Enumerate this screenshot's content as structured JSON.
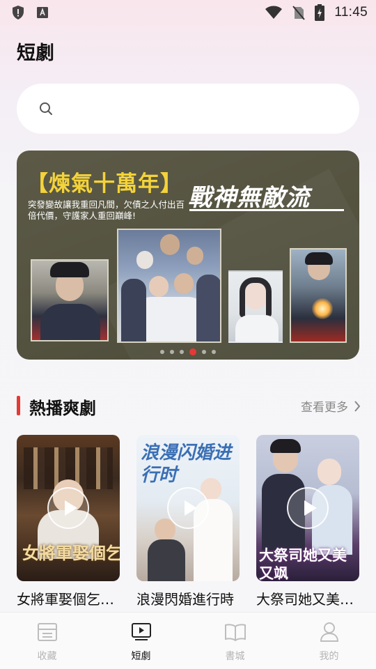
{
  "status_bar": {
    "time": "11:45"
  },
  "header": {
    "title": "短劇"
  },
  "search": {
    "placeholder": ""
  },
  "banner": {
    "title_left": "【煉氣十萬年】",
    "title_right": "戰神無敵流",
    "description": "突發變故讓我重回凡間，欠債之人付出百倍代價，守護家人重回巔峰!",
    "page_count": 6,
    "active_page": 3
  },
  "section": {
    "title": "熱播爽劇",
    "see_more": "查看更多"
  },
  "cards": [
    {
      "title": "女將軍娶個乞丐當王妃",
      "art_text": "女將軍娶個乞丐"
    },
    {
      "title": "浪漫閃婚進行時",
      "art_text": "浪漫闪婚进行时"
    },
    {
      "title": "大祭司她又美又颯",
      "art_text": "大祭司她又美又飒"
    }
  ],
  "bottom_nav": [
    {
      "label": "收藏",
      "icon": "bookmark-list-icon",
      "active": false
    },
    {
      "label": "短劇",
      "icon": "tv-play-icon",
      "active": true
    },
    {
      "label": "書城",
      "icon": "open-book-icon",
      "active": false
    },
    {
      "label": "我的",
      "icon": "person-icon",
      "active": false
    }
  ],
  "colors": {
    "accent": "#e53935",
    "banner_title": "#f4d33a"
  }
}
